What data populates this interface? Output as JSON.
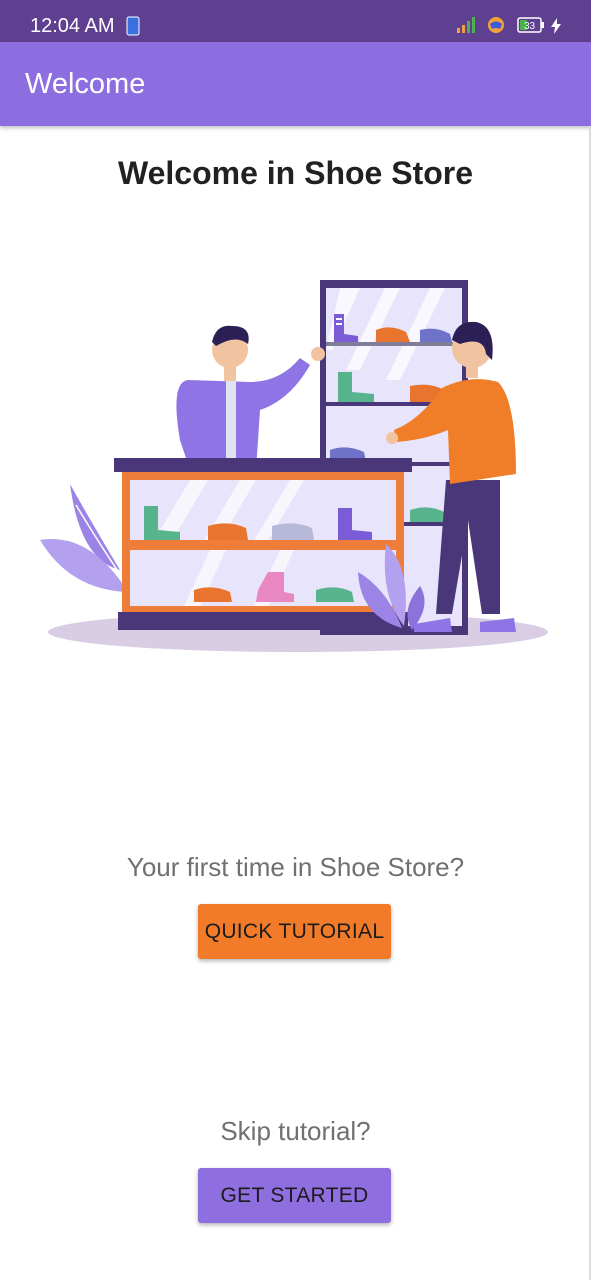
{
  "status_bar": {
    "time": "12:04 AM",
    "battery_level": "33",
    "icons": [
      "sim-card-icon",
      "signal-bars-icon",
      "vpn-shield-icon",
      "battery-icon",
      "charging-bolt-icon"
    ]
  },
  "app_bar": {
    "title": "Welcome"
  },
  "main": {
    "heading": "Welcome in Shoe Store",
    "illustration": "shoe-store-illustration",
    "tutorial_prompt": "Your first time in Shoe Store?",
    "tutorial_button": "QUICK TUTORIAL",
    "skip_prompt": "Skip tutorial?",
    "start_button": "GET STARTED"
  },
  "colors": {
    "status_bar": "#5f3f8f",
    "app_bar": "#8d6ee0",
    "accent_orange": "#f27b2a",
    "accent_purple": "#8f6ee0",
    "heading_text": "#212121",
    "prompt_text": "#707070"
  }
}
